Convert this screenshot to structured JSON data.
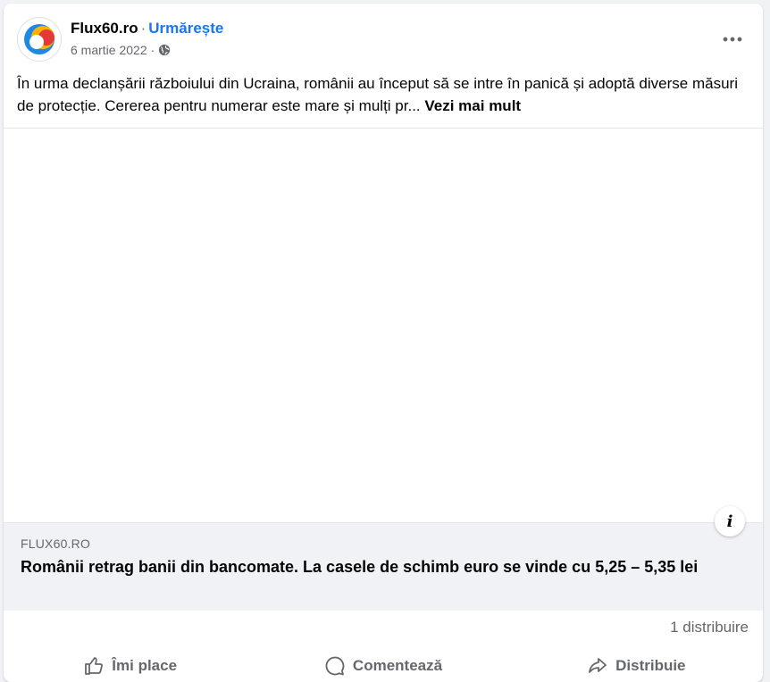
{
  "post": {
    "page_name": "Flux60.ro",
    "separator": "·",
    "follow_label": "Urmărește",
    "date": "6 martie 2022",
    "date_separator": "·",
    "audience_icon": "globe-icon",
    "more_icon": "more-options-icon",
    "text": "În urma declanșării războiului din Ucraina, românii au început să se intre în panică și adoptă diverse măsuri de protecție. Cererea pentru numerar este mare și mulți pr... ",
    "see_more_label": "Vezi mai mult"
  },
  "link_preview": {
    "domain": "FLUX60.RO",
    "title": "Românii retrag banii din bancomate. La casele de schimb euro se vinde cu 5,25 – 5,35 lei",
    "info_label": "i"
  },
  "stats": {
    "shares": "1 distribuire"
  },
  "actions": {
    "like_label": "Îmi place",
    "comment_label": "Comentează",
    "share_label": "Distribuie"
  },
  "colors": {
    "accent": "#1877f2",
    "muted_text": "#65676b",
    "logo_blue": "#1e88e5",
    "logo_orange": "#ff9800",
    "logo_red": "#e53935"
  }
}
